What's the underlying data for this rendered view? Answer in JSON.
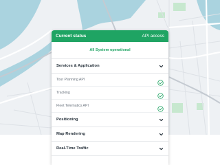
{
  "colors": {
    "accent": "#1fa463",
    "map_water": "#aad3df",
    "map_land": "#eef1f4",
    "map_park": "#c7e8cf",
    "map_road": "#ffffff",
    "map_highway": "#c4cad1",
    "map_street": "#dde1e6"
  },
  "header": {
    "title": "Current status",
    "link": "API access"
  },
  "status": {
    "message": "All System operational"
  },
  "sections": [
    {
      "label": "Services & Application",
      "icon": "chevron-down-icon",
      "expanded": true,
      "items": [
        {
          "label": "Tour Planning API",
          "status_icon": "check-circle-icon"
        },
        {
          "label": "Tracking",
          "status_icon": "check-circle-icon"
        },
        {
          "label": "Fleet Telematics API",
          "status_icon": "check-circle-icon"
        }
      ]
    },
    {
      "label": "Positioning",
      "icon": "chevron-down-icon",
      "expanded": false
    },
    {
      "label": "Map Rendering",
      "icon": "chevron-down-icon",
      "expanded": false
    },
    {
      "label": "Real-Time Traffic",
      "icon": "chevron-down-icon",
      "expanded": false
    }
  ]
}
